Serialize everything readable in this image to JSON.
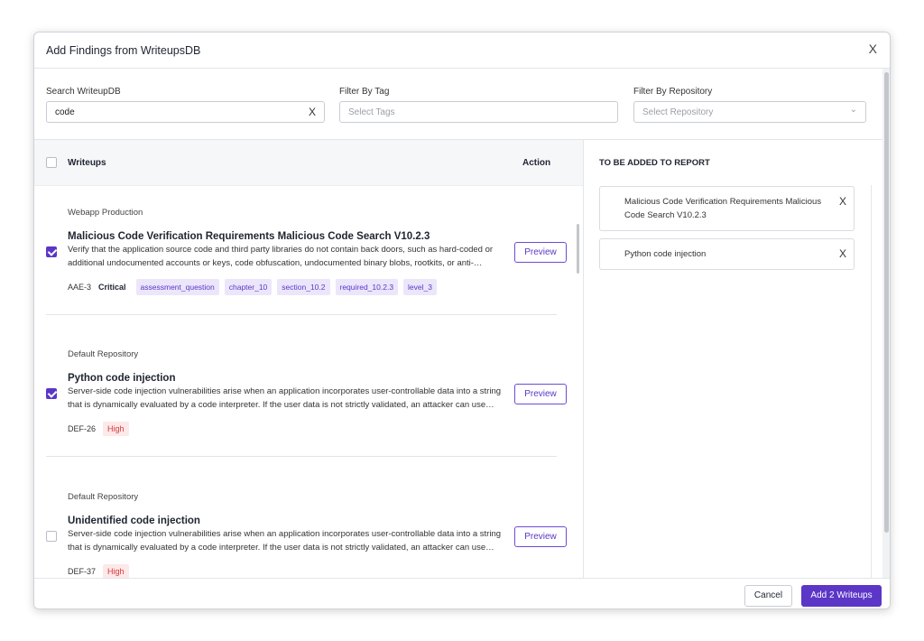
{
  "modal": {
    "title": "Add Findings from WriteupsDB",
    "close_icon": "close-icon",
    "close_glyph": "X"
  },
  "filters": {
    "search": {
      "label": "Search WriteupDB",
      "value": "code",
      "clear_glyph": "X"
    },
    "tag": {
      "label": "Filter By Tag",
      "placeholder": "Select Tags"
    },
    "repository": {
      "label": "Filter By Repository",
      "placeholder": "Select Repository",
      "chevron_glyph": "⌄"
    }
  },
  "list": {
    "columns": {
      "writeups": "Writeups",
      "action": "Action"
    },
    "items": [
      {
        "repository": "Webapp Production",
        "title": "Malicious Code Verification Requirements Malicious Code Search V10.2.3",
        "description": "Verify that the application source code and third party libraries do not contain back doors, such as hard-coded or\nadditional undocumented accounts or keys, code obfuscation, undocumented binary blobs, rootkits, or anti-…",
        "preview_label": "Preview",
        "id": "AAE-3",
        "severity": "Critical",
        "tags": [
          "assessment_question",
          "chapter_10",
          "section_10.2",
          "required_10.2.3",
          "level_3"
        ],
        "checked": true
      },
      {
        "repository": "Default Repository",
        "title": "Python code injection",
        "description": "Server-side code injection vulnerabilities arise when an application incorporates user-controllable data into a string\nthat is dynamically evaluated by a code interpreter. If the user data is not strictly validated, an attacker can use…",
        "preview_label": "Preview",
        "id": "DEF-26",
        "severity": "High",
        "tags": [],
        "checked": true
      },
      {
        "repository": "Default Repository",
        "title": "Unidentified code injection",
        "description": "Server-side code injection vulnerabilities arise when an application incorporates user-controllable data into a string\nthat is dynamically evaluated by a code interpreter. If the user data is not strictly validated, an attacker can use…",
        "preview_label": "Preview",
        "id": "DEF-37",
        "severity": "High",
        "tags": [],
        "checked": false
      }
    ]
  },
  "report": {
    "title": "TO BE ADDED TO REPORT",
    "remove_glyph": "X",
    "added": [
      {
        "label": "Malicious Code Verification Requirements Malicious Code Search V10.2.3"
      },
      {
        "label": "Python code injection"
      }
    ]
  },
  "footer": {
    "cancel_label": "Cancel",
    "add_label": "Add 2 Writeups"
  },
  "colors": {
    "accent": "#5b36c7",
    "tag_bg": "#ece6fb",
    "high": "#d43b3b",
    "high_bg": "#fde9e9"
  }
}
